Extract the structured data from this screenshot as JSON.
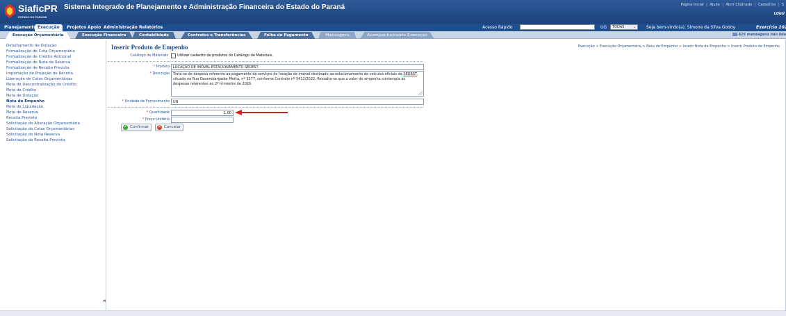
{
  "header": {
    "app_name": "SiaficPR",
    "app_sub": "ESTADO DO PARANÁ",
    "system_title": "Sistema Integrado de Planejamento e Administração Financeira do Estado do Paraná",
    "top_links": [
      "Página Inicial",
      "Ajuda",
      "Abrir Chamado",
      "Cadastros",
      "S"
    ],
    "brand_right": "LOGU"
  },
  "menu": {
    "items": [
      "Planejamento",
      "Execução",
      "Projetos",
      "Apoio",
      "Administração",
      "Relatórios"
    ],
    "active": "Execução",
    "acesso_rapido_label": "Acesso Rápido",
    "acesso_rapido_value": "",
    "ug_label": "UG",
    "ug_value": "TODAS",
    "welcome": "Seja bem-vindo(a), Simone da Silva Godoy",
    "exercicio": "Exercício 202"
  },
  "subtabs": {
    "items": [
      "Execução Orçamentária",
      "Execução Financeira",
      "Contabilidade",
      "Contratos e Transferências",
      "Folha de Pagamento",
      "Mensagens",
      "Acompanhamento Execução"
    ],
    "messages": "626 mensagens não lida"
  },
  "sidebar": {
    "items": [
      "Detalhamento de Dotação",
      "Formalização de Cota Orçamentária",
      "Formalização de Crédito Adicional",
      "Formalização de Nota de Reserva",
      "Formalização de Receita Prevista",
      "Importação de Projeção de Receita",
      "Liberação de Cotas Orçamentárias",
      "Nota de Descentralização de Crédito",
      "Nota de Crédito",
      "Nota de Dotação",
      "Nota de Empenho",
      "Nota de Liquidação",
      "Nota de Reserva",
      "Receita Prevista",
      "Solicitação de Alteração Orçamentária",
      "Solicitação de Cotas Orçamentárias",
      "Solicitação de Nota Reserva",
      "Solicitação de Receita Prevista"
    ],
    "active_index": 10
  },
  "main": {
    "title": "Inserir Produto de Empenho",
    "breadcrumb": "Execução > Execução Orçamentária > Nota de Empenho > Inserir Nota de Empenho > Inserir Produto de Empenho",
    "catalogo_label": "Catálogo de Materiais",
    "catalogo_checkbox_label": "Utilizar cadastro de produtos do Catálogo de Materiais.",
    "produto_label": "Produto",
    "produto_value": "LOCAÇÃO DE IMÓVEL ESTACIONAMENTO SEDEST.",
    "descricao_label": "Descrição",
    "descricao_part1": "Trata-se de despesa referente ao pagamento de serviços de locação de imóvel destinado ao estacionamento de veículos oficiais da ",
    "descricao_sedest": "SEDEST",
    "descricao_part2": ", situado na Rua Desembargador Motta, nº 3377, conforme Contrato nº 5412/2022. Ressalta-se que o valor do empenho contempla as despesas referentes ao 2º trimestre de 2026.",
    "unidade_label": "Unidade de Fornecimento",
    "unidade_value": "UN",
    "quantidade_label": "Quantidade",
    "quantidade_value": "1,00",
    "preco_label": "Preço Unitário",
    "preco_value": "",
    "confirmar_label": "Confirmar",
    "cancelar_label": "Cancelar"
  },
  "colors": {
    "header_blue": "#1f4f8f",
    "link_blue": "#2a5590",
    "annotation_arrow": "#d42020"
  }
}
